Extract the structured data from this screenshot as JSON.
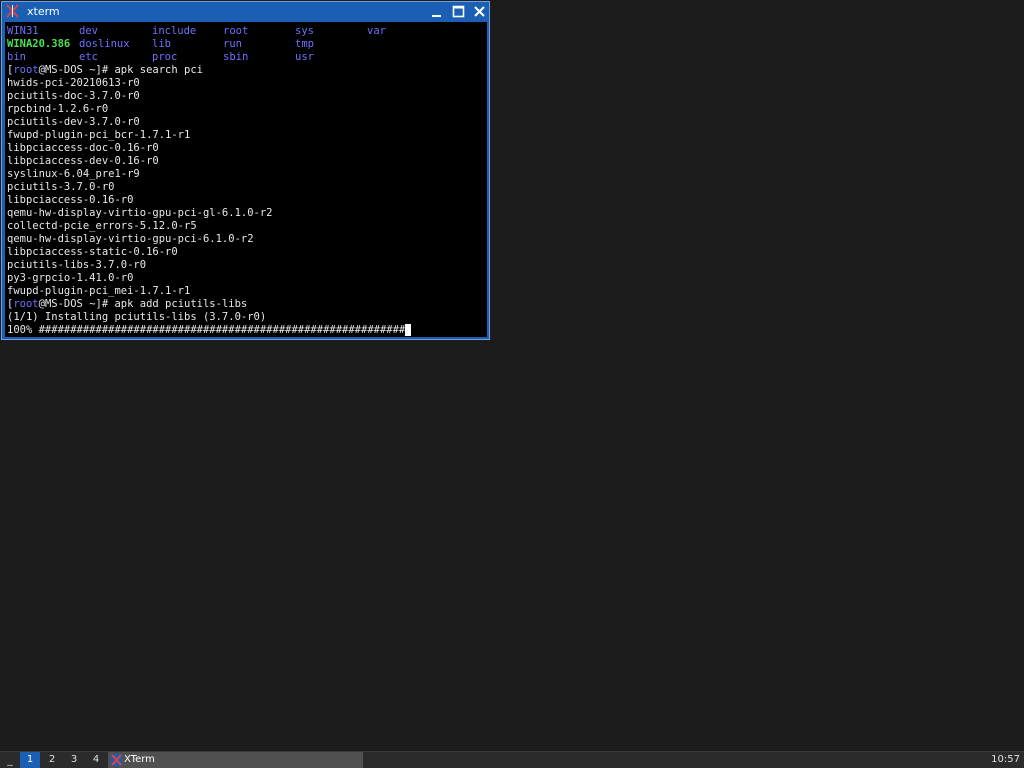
{
  "window": {
    "title": "xterm",
    "icon": "xterm-icon",
    "controls": {
      "minimize": "minimize-icon",
      "maximize": "maximize-icon",
      "close": "close-icon"
    }
  },
  "terminal": {
    "ls_columns": [
      [
        "WIN31",
        "WINA20.386",
        "bin"
      ],
      [
        "dev",
        "doslinux",
        "etc"
      ],
      [
        "include",
        "lib",
        "proc"
      ],
      [
        "root",
        "run",
        "sbin"
      ],
      [
        "sys",
        "tmp",
        "usr"
      ],
      [
        "var"
      ]
    ],
    "prompt1": {
      "open": "[",
      "user": "root",
      "host": "@MS-DOS ~]# ",
      "command": "apk search pci"
    },
    "search_results": [
      "hwids-pci-20210613-r0",
      "pciutils-doc-3.7.0-r0",
      "rpcbind-1.2.6-r0",
      "pciutils-dev-3.7.0-r0",
      "fwupd-plugin-pci_bcr-1.7.1-r1",
      "libpciaccess-doc-0.16-r0",
      "libpciaccess-dev-0.16-r0",
      "syslinux-6.04_pre1-r9",
      "pciutils-3.7.0-r0",
      "libpciaccess-0.16-r0",
      "qemu-hw-display-virtio-gpu-pci-gl-6.1.0-r2",
      "collectd-pcie_errors-5.12.0-r5",
      "qemu-hw-display-virtio-gpu-pci-6.1.0-r2",
      "libpciaccess-static-0.16-r0",
      "pciutils-libs-3.7.0-r0",
      "py3-grpcio-1.41.0-r0",
      "fwupd-plugin-pci_mei-1.7.1-r1"
    ],
    "prompt2": {
      "open": "[",
      "user": "root",
      "host": "@MS-DOS ~]# ",
      "command": "apk add pciutils-libs"
    },
    "install_line": "(1/1) Installing pciutils-libs (3.7.0-r0)",
    "progress_line": "100% ##########################################################",
    "progress": 1.0,
    "colors": {
      "dir": "#6f6fff",
      "exec": "#4fe04f",
      "text": "#e8e8e8"
    }
  },
  "taskbar": {
    "show_desktop_label": "_",
    "workspaces": [
      "1",
      "2",
      "3",
      "4"
    ],
    "active_workspace": "1",
    "task_label": "XTerm",
    "clock": "10:57"
  }
}
